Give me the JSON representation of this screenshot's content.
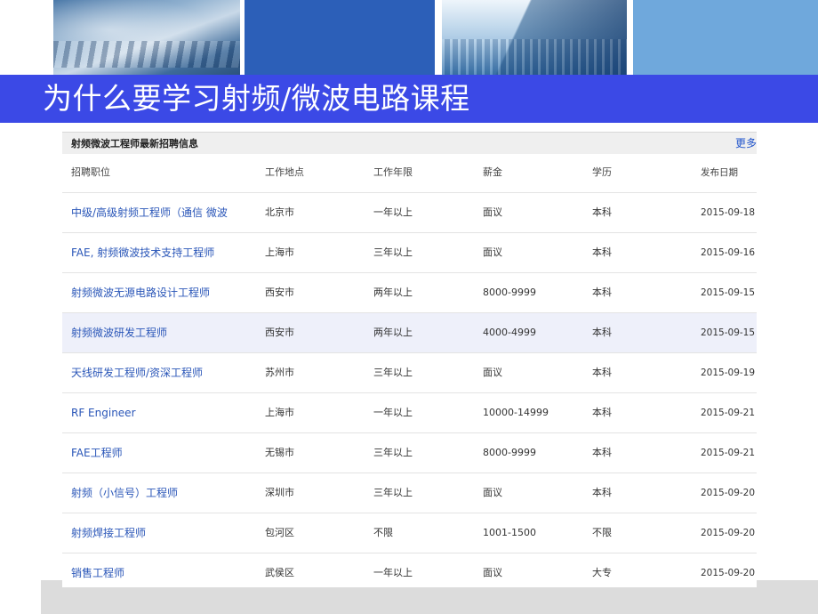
{
  "slide_title": "为什么要学习射频/微波电路课程",
  "panel": {
    "title": "射频微波工程师最新招聘信息",
    "more": "更多"
  },
  "columns": {
    "job": "招聘职位",
    "location": "工作地点",
    "years": "工作年限",
    "salary": "薪金",
    "education": "学历",
    "date": "发布日期"
  },
  "rows": [
    {
      "job": "中级/高级射频工程师（通信 微波",
      "location": "北京市",
      "years": "一年以上",
      "salary": "面议",
      "education": "本科",
      "date": "2015-09-18",
      "highlight": false
    },
    {
      "job": "FAE, 射频微波技术支持工程师",
      "location": "上海市",
      "years": "三年以上",
      "salary": "面议",
      "education": "本科",
      "date": "2015-09-16",
      "highlight": false
    },
    {
      "job": "射频微波无源电路设计工程师",
      "location": "西安市",
      "years": "两年以上",
      "salary": "8000-9999",
      "education": "本科",
      "date": "2015-09-15",
      "highlight": false
    },
    {
      "job": "射频微波研发工程师",
      "location": "西安市",
      "years": "两年以上",
      "salary": "4000-4999",
      "education": "本科",
      "date": "2015-09-15",
      "highlight": true
    },
    {
      "job": "天线研发工程师/资深工程师",
      "location": "苏州市",
      "years": "三年以上",
      "salary": "面议",
      "education": "本科",
      "date": "2015-09-19",
      "highlight": false
    },
    {
      "job": "RF Engineer",
      "location": "上海市",
      "years": "一年以上",
      "salary": "10000-14999",
      "education": "本科",
      "date": "2015-09-21",
      "highlight": false
    },
    {
      "job": "FAE工程师",
      "location": "无锡市",
      "years": "三年以上",
      "salary": "8000-9999",
      "education": "本科",
      "date": "2015-09-21",
      "highlight": false
    },
    {
      "job": "射频（小信号）工程师",
      "location": "深圳市",
      "years": "三年以上",
      "salary": "面议",
      "education": "本科",
      "date": "2015-09-20",
      "highlight": false
    },
    {
      "job": "射频焊接工程师",
      "location": "包河区",
      "years": "不限",
      "salary": "1001-1500",
      "education": "不限",
      "date": "2015-09-20",
      "highlight": false
    },
    {
      "job": "销售工程师",
      "location": "武侯区",
      "years": "一年以上",
      "salary": "面议",
      "education": "大专",
      "date": "2015-09-20",
      "highlight": false
    }
  ]
}
